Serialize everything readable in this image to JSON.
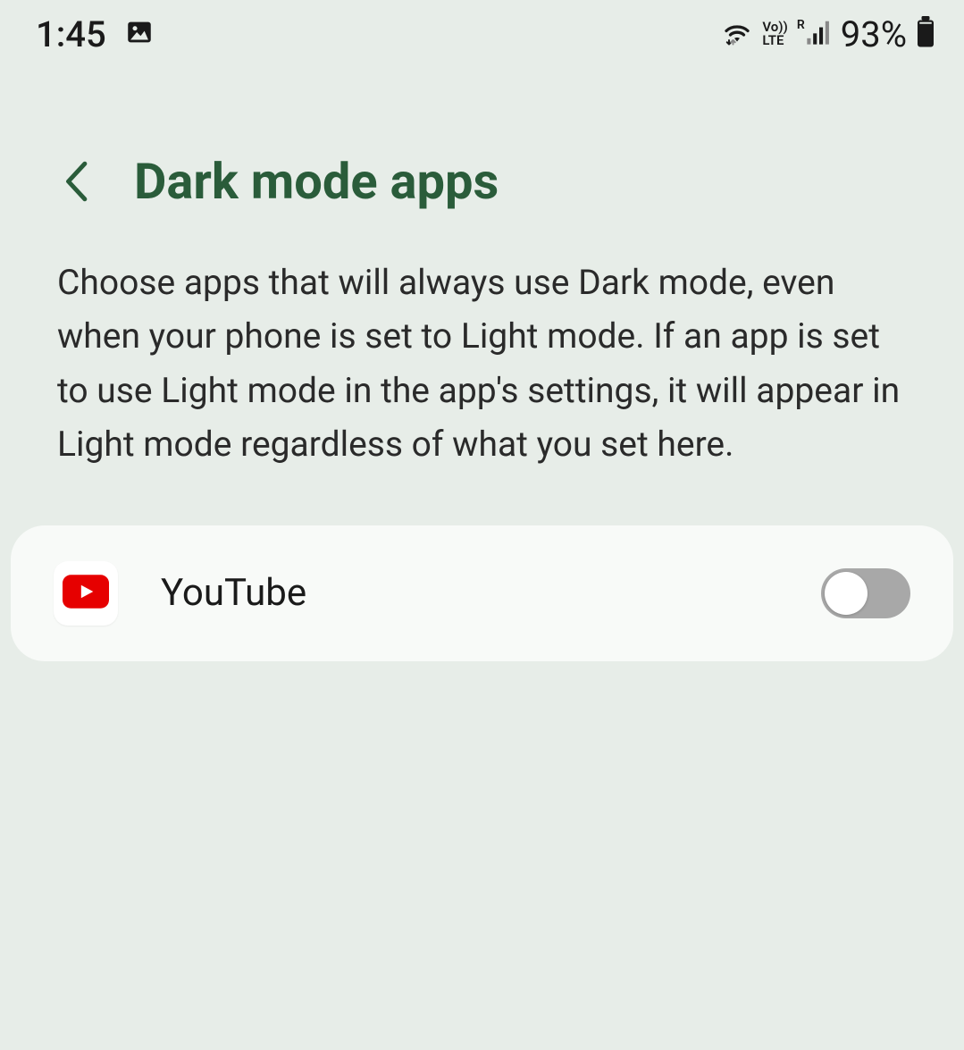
{
  "statusbar": {
    "time": "1:45",
    "battery": "93%",
    "network": {
      "volte_top": "Vo))",
      "volte_bottom": "LTE",
      "roaming": "R"
    }
  },
  "header": {
    "title": "Dark mode apps"
  },
  "description": "Choose apps that will always use Dark mode, even when your phone is set to Light mode. If an app is set to use Light mode in the app's settings, it will appear in Light mode regardless of what you set here.",
  "apps": [
    {
      "name": "YouTube",
      "icon": "youtube-icon",
      "enabled": false
    }
  ]
}
